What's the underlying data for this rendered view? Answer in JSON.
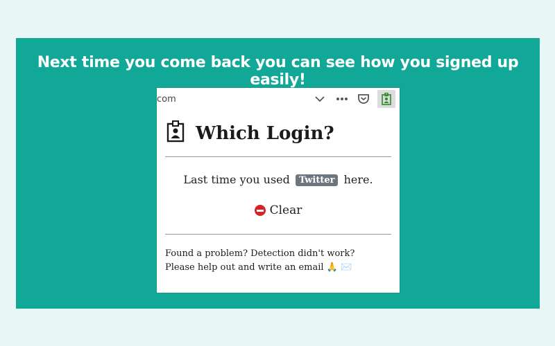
{
  "headline": "Next time you come back you can see how you signed up easily!",
  "browser": {
    "url_fragment": "com",
    "dropdown_icon": "chevron-down-icon",
    "menu_icon": "more-dots-icon",
    "pocket_icon": "pocket-icon",
    "extension_icon": "id-badge-icon"
  },
  "popup": {
    "title": "Which Login?",
    "last_prefix": "Last time you used",
    "provider_badge": "Twitter",
    "last_suffix": "here.",
    "clear_label": "Clear",
    "footer_line1": "Found a problem? Detection didn't work?",
    "footer_line2": "Please help out and write an email",
    "footer_emoji": "🙏 ✉️"
  },
  "colors": {
    "panel": "#12a898",
    "background": "#e9f6f6",
    "badge": "#6c7680",
    "clear_icon": "#d6232a"
  }
}
